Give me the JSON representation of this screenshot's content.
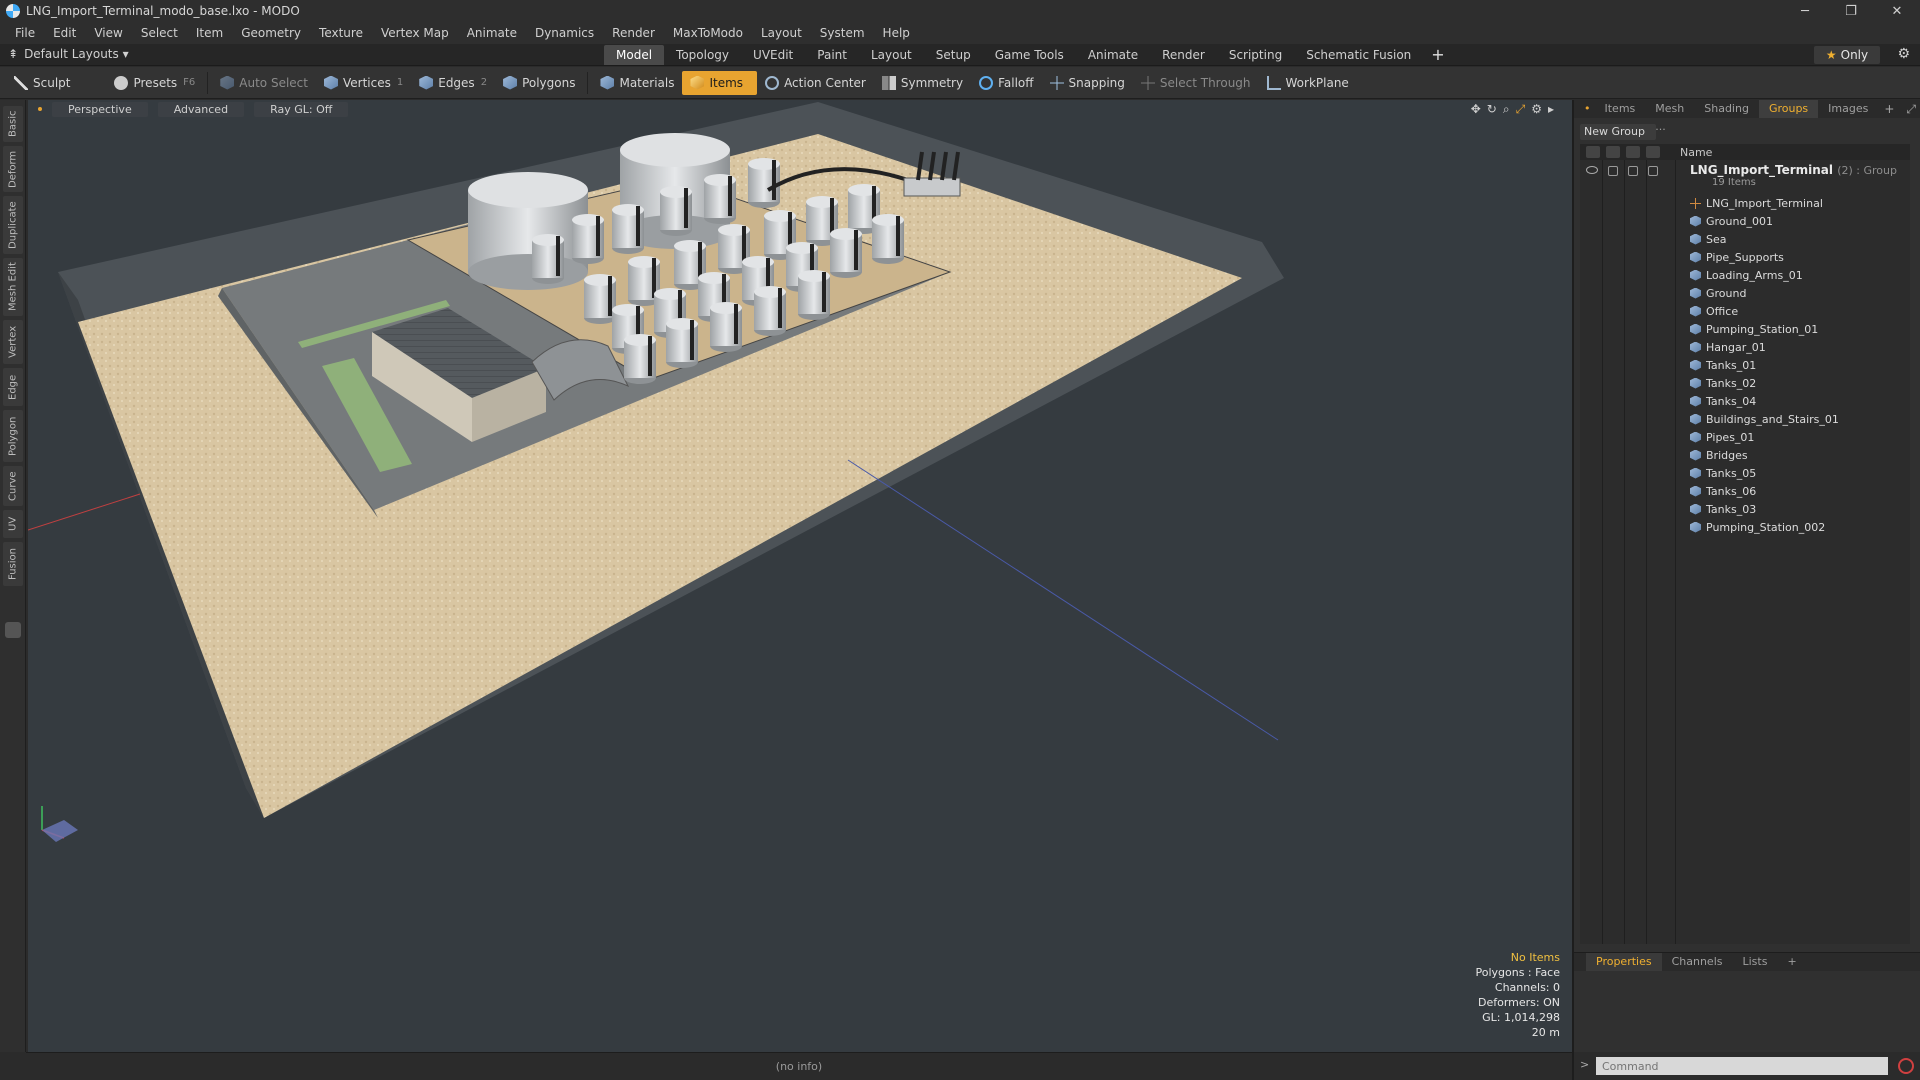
{
  "window": {
    "title": "LNG_Import_Terminal_modo_base.lxo - MODO",
    "controls": [
      "─",
      "❐",
      "✕"
    ]
  },
  "menu": [
    "File",
    "Edit",
    "View",
    "Select",
    "Item",
    "Geometry",
    "Texture",
    "Vertex Map",
    "Animate",
    "Dynamics",
    "Render",
    "MaxToModo",
    "Layout",
    "System",
    "Help"
  ],
  "layout_bar": {
    "layouts_label": "Default Layouts ▾",
    "tabs": [
      "Model",
      "Topology",
      "UVEdit",
      "Paint",
      "Layout",
      "Setup",
      "Game Tools",
      "Animate",
      "Render",
      "Scripting",
      "Schematic Fusion"
    ],
    "active_tab": "Model",
    "only_label": "Only"
  },
  "toolbar": {
    "sculpt": "Sculpt",
    "presets": "Presets",
    "presets_key": "F6",
    "auto_select": "Auto Select",
    "vertices": "Vertices",
    "vertices_count": "1",
    "edges": "Edges",
    "edges_count": "2",
    "polygons": "Polygons",
    "materials": "Materials",
    "items": "Items",
    "action_center": "Action Center",
    "symmetry": "Symmetry",
    "falloff": "Falloff",
    "snapping": "Snapping",
    "select_through": "Select Through",
    "workplane": "WorkPlane"
  },
  "left_strip": [
    "Basic",
    "Deform",
    "Duplicate",
    "Mesh Edit",
    "Vertex",
    "Edge",
    "Polygon",
    "Curve",
    "UV",
    "Fusion"
  ],
  "viewport": {
    "view_mode": "Perspective",
    "shading": "Advanced",
    "raygl": "Ray GL: Off",
    "info": {
      "selection": "No Items",
      "polygons": "Polygons : Face",
      "channels": "Channels: 0",
      "deformers": "Deformers: ON",
      "gl": "GL: 1,014,298",
      "scale": "20 m"
    }
  },
  "status_bar": {
    "text": "(no info)"
  },
  "right_panel": {
    "tabs": [
      "Items",
      "Mesh ...",
      "Shading",
      "Groups",
      "Images"
    ],
    "active_tab": "Groups",
    "new_group": "New Group",
    "name_header": "Name",
    "root": {
      "name": "LNG_Import_Terminal",
      "suffix": "(2) : Group",
      "count": "19 Items"
    },
    "items": [
      "LNG_Import_Terminal",
      "Ground_001",
      "Sea",
      "Pipe_Supports",
      "Loading_Arms_01",
      "Ground",
      "Office",
      "Pumping_Station_01",
      "Hangar_01",
      "Tanks_01",
      "Tanks_02",
      "Tanks_04",
      "Buildings_and_Stairs_01",
      "Pipes_01",
      "Bridges",
      "Tanks_05",
      "Tanks_06",
      "Tanks_03",
      "Pumping_Station_002"
    ]
  },
  "properties": {
    "tabs": [
      "Properties",
      "Channels",
      "Lists"
    ],
    "active_tab": "Properties"
  },
  "command": {
    "placeholder": "Command"
  },
  "colors": {
    "accent": "#e8a430",
    "viewport_bg": "#353b40",
    "sand": "#d8c4a0"
  }
}
